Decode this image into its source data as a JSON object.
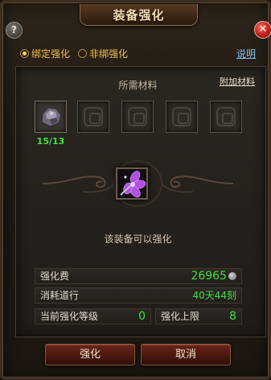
{
  "window": {
    "title": "装备强化",
    "help_icon": "?",
    "close_icon": "✕"
  },
  "bind_options": [
    {
      "label": "绑定强化",
      "selected": true
    },
    {
      "label": "非绑强化",
      "selected": false
    }
  ],
  "explain_link": "说明",
  "materials": {
    "title": "所需材料",
    "extra_button": "附加材料",
    "slots": [
      {
        "icon": "ore-icon",
        "count": "15/13"
      },
      {
        "icon": "empty-slot-icon"
      },
      {
        "icon": "empty-slot-icon"
      },
      {
        "icon": "empty-slot-icon"
      },
      {
        "icon": "empty-slot-icon"
      }
    ]
  },
  "equipment": {
    "icon": "purple-flower-weapon-icon",
    "status_text": "该装备可以强化"
  },
  "stats": {
    "cost_label": "强化费",
    "cost_value": "26965",
    "cost_icon": "silver-coin-icon",
    "time_label": "消耗道行",
    "time_value": "40天44刻",
    "level_label": "当前强化等级",
    "level_value": "0",
    "limit_label": "强化上限",
    "limit_value": "8"
  },
  "buttons": {
    "confirm": "强化",
    "cancel": "取消"
  },
  "colors": {
    "accent_gold": "#f0c050",
    "value_green": "#40e040",
    "link_blue": "#7ec4f0",
    "button_red": "#6a2418"
  }
}
